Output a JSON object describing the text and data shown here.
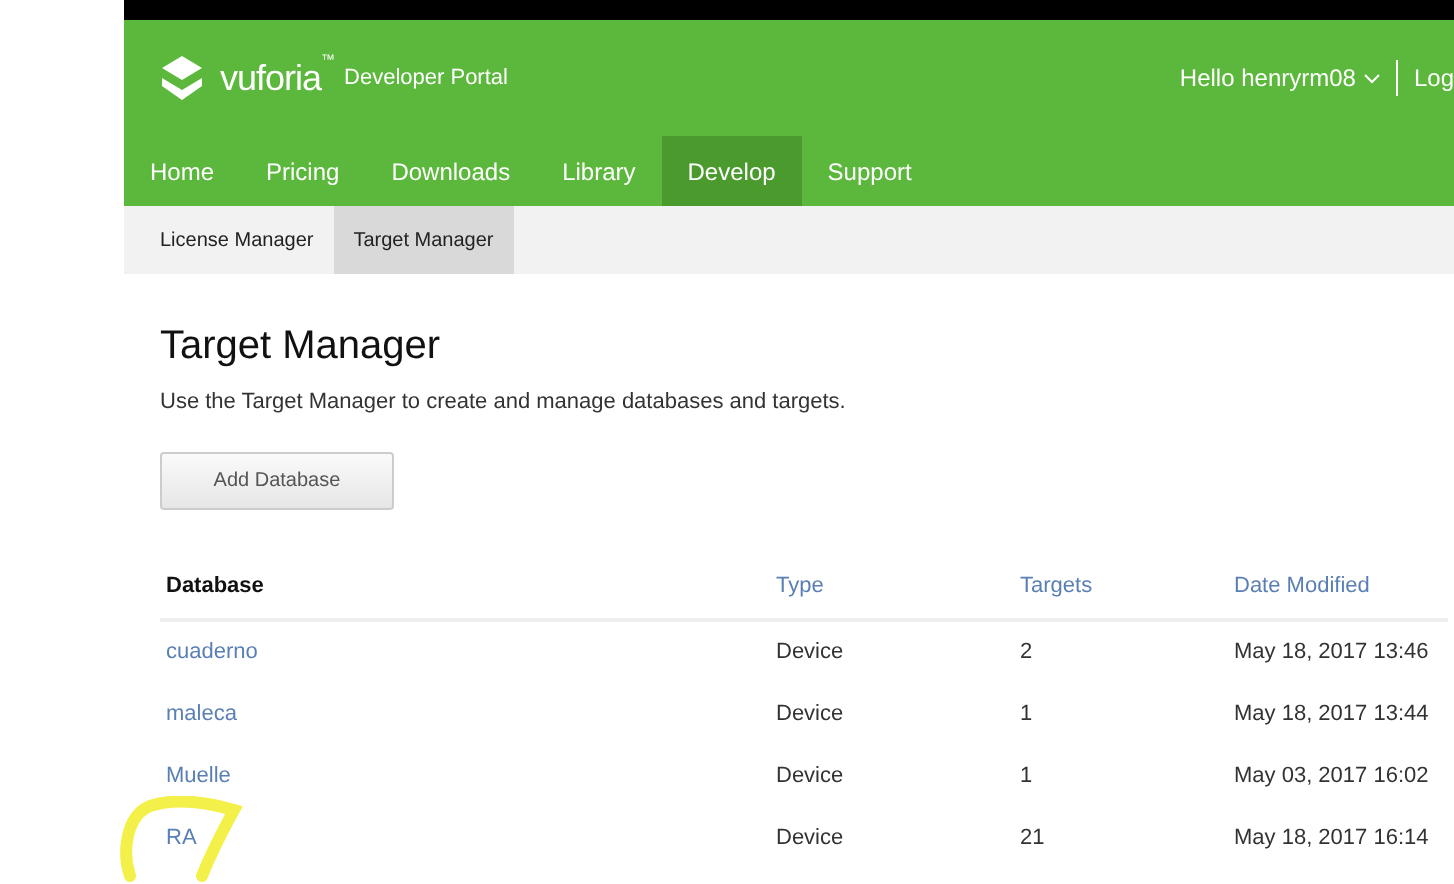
{
  "header": {
    "logo": "vuforia",
    "trademark": "™",
    "portal": "Developer Portal",
    "greeting": "Hello henryrm08",
    "logout": "Log"
  },
  "nav": [
    {
      "label": "Home",
      "selected": false
    },
    {
      "label": "Pricing",
      "selected": false
    },
    {
      "label": "Downloads",
      "selected": false
    },
    {
      "label": "Library",
      "selected": false
    },
    {
      "label": "Develop",
      "selected": true
    },
    {
      "label": "Support",
      "selected": false
    }
  ],
  "subnav": [
    {
      "label": "License Manager",
      "selected": false
    },
    {
      "label": "Target Manager",
      "selected": true
    }
  ],
  "page": {
    "title": "Target Manager",
    "description": "Use the Target Manager to create and manage databases and targets.",
    "button": "Add Database"
  },
  "table": {
    "columns": [
      {
        "label": "Database",
        "sortable": false
      },
      {
        "label": "Type",
        "sortable": true
      },
      {
        "label": "Targets",
        "sortable": true
      },
      {
        "label": "Date Modified",
        "sortable": true
      }
    ],
    "rows": [
      {
        "database": "cuaderno",
        "type": "Device",
        "targets": "2",
        "date": "May 18, 2017 13:46",
        "highlighted": false
      },
      {
        "database": "maleca",
        "type": "Device",
        "targets": "1",
        "date": "May 18, 2017 13:44",
        "highlighted": false
      },
      {
        "database": "Muelle",
        "type": "Device",
        "targets": "1",
        "date": "May 03, 2017 16:02",
        "highlighted": false
      },
      {
        "database": "RA",
        "type": "Device",
        "targets": "21",
        "date": "May 18, 2017 16:14",
        "highlighted": true
      }
    ]
  }
}
